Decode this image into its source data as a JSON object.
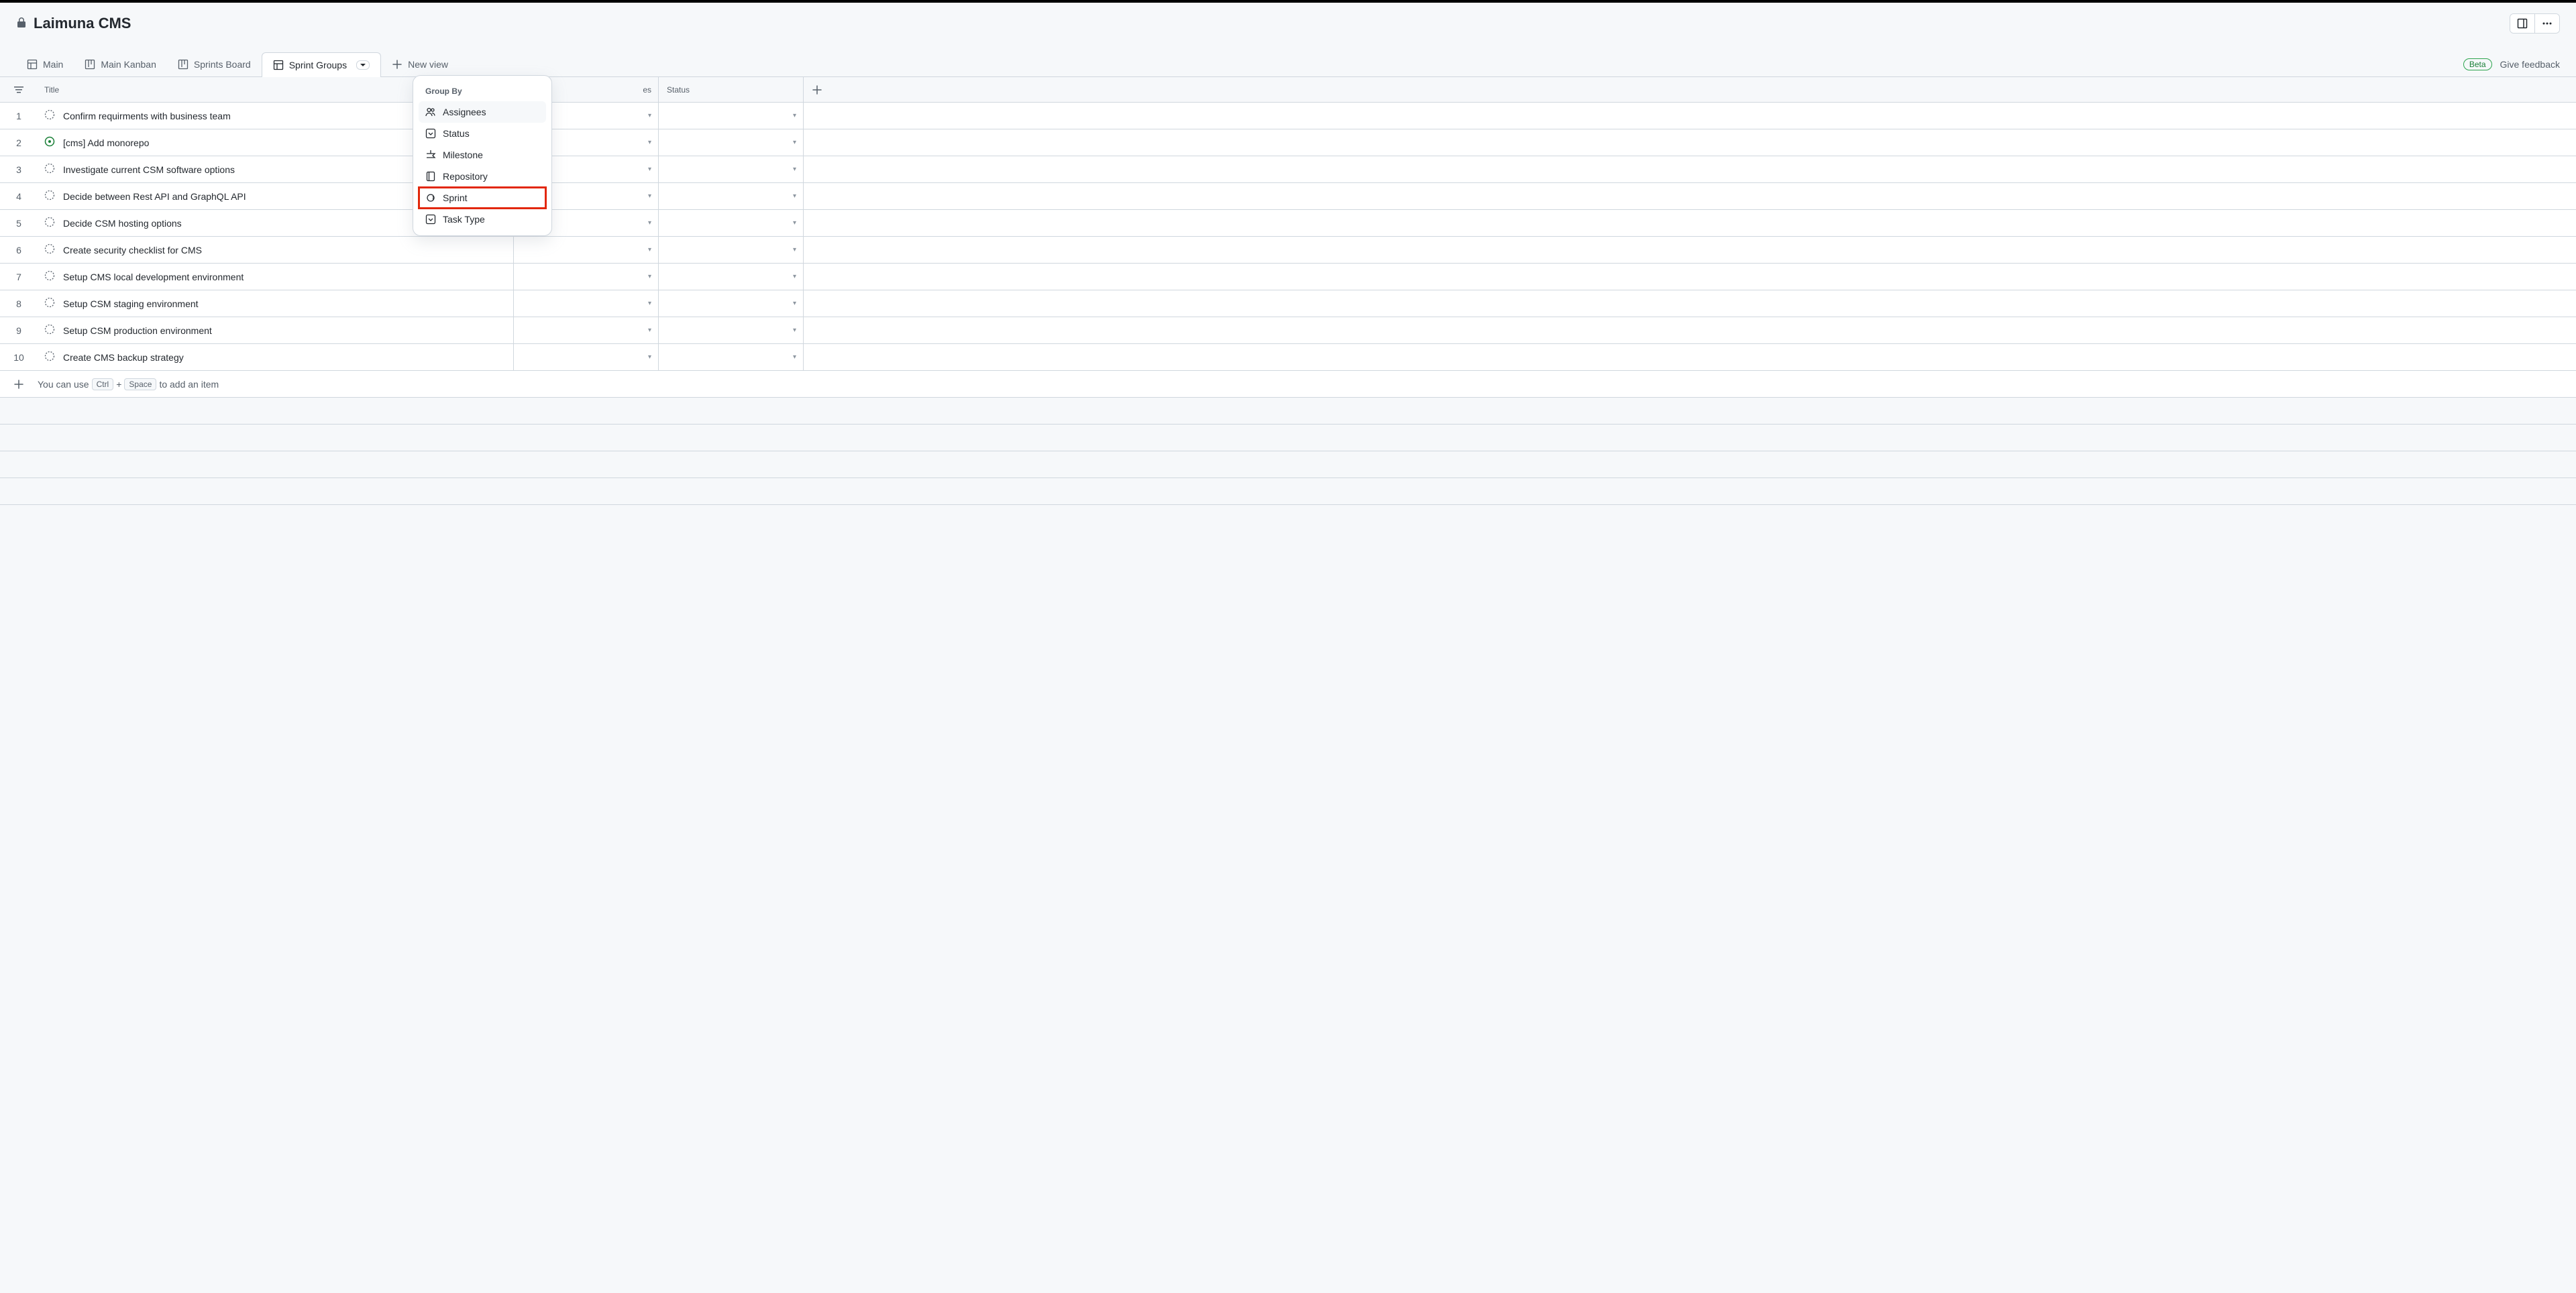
{
  "project": {
    "title": "Laimuna CMS"
  },
  "tabs": [
    {
      "label": "Main",
      "icon": "table"
    },
    {
      "label": "Main Kanban",
      "icon": "kanban"
    },
    {
      "label": "Sprints Board",
      "icon": "kanban"
    },
    {
      "label": "Sprint Groups",
      "icon": "table",
      "active": true
    }
  ],
  "new_view_label": "New view",
  "beta_label": "Beta",
  "feedback_label": "Give feedback",
  "columns": {
    "title": "Title",
    "assignees_partial": "es",
    "status": "Status"
  },
  "rows": [
    {
      "num": "1",
      "title": "Confirm requirments with business team",
      "type": "draft"
    },
    {
      "num": "2",
      "title": "[cms] Add monorepo",
      "type": "issue"
    },
    {
      "num": "3",
      "title": "Investigate current CSM software options",
      "type": "draft"
    },
    {
      "num": "4",
      "title": "Decide between Rest API and GraphQL API",
      "type": "draft"
    },
    {
      "num": "5",
      "title": "Decide CSM hosting options",
      "type": "draft"
    },
    {
      "num": "6",
      "title": "Create security checklist for CMS",
      "type": "draft"
    },
    {
      "num": "7",
      "title": "Setup CMS local development environment",
      "type": "draft"
    },
    {
      "num": "8",
      "title": "Setup CSM staging environment",
      "type": "draft"
    },
    {
      "num": "9",
      "title": "Setup CSM production environment",
      "type": "draft"
    },
    {
      "num": "10",
      "title": "Create CMS backup strategy",
      "type": "draft"
    }
  ],
  "add_row": {
    "prefix": "You can use",
    "kbd1": "Ctrl",
    "plus": "+",
    "kbd2": "Space",
    "suffix": "to add an item"
  },
  "dropdown": {
    "header": "Group By",
    "items": [
      {
        "label": "Assignees",
        "icon": "people",
        "selected": true
      },
      {
        "label": "Status",
        "icon": "single-select"
      },
      {
        "label": "Milestone",
        "icon": "milestone"
      },
      {
        "label": "Repository",
        "icon": "repo"
      },
      {
        "label": "Sprint",
        "icon": "iteration",
        "highlighted": true
      },
      {
        "label": "Task Type",
        "icon": "single-select"
      }
    ]
  }
}
